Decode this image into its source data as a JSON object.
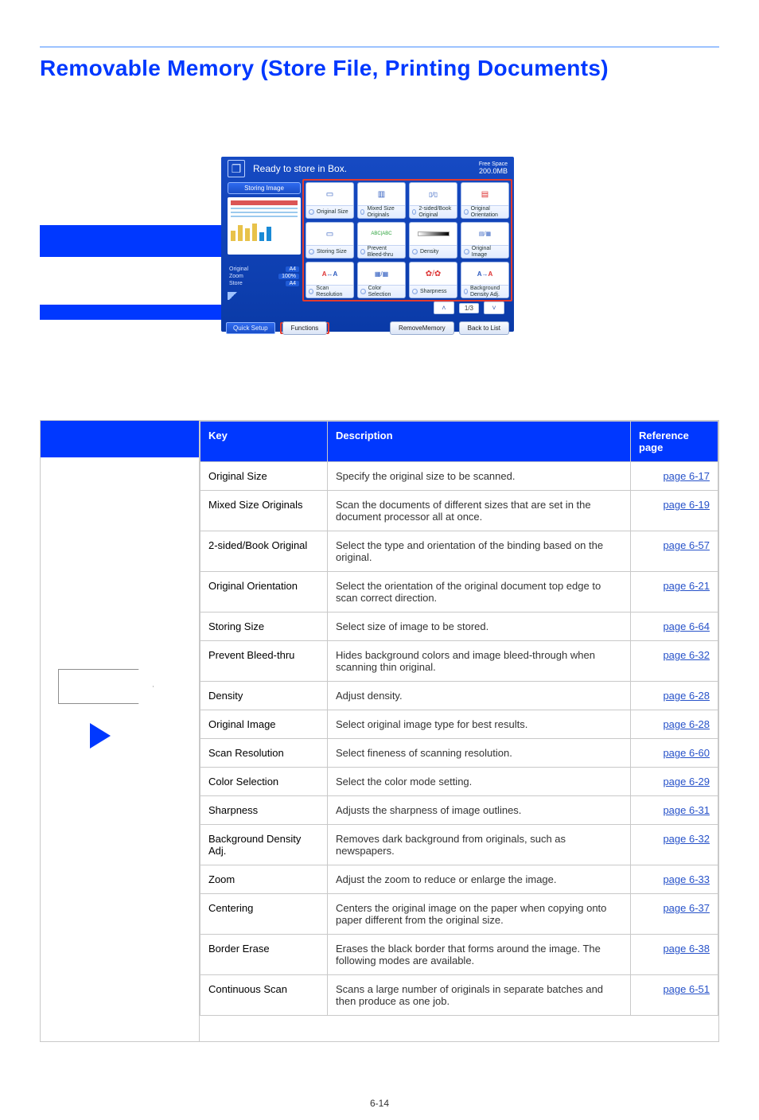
{
  "page_title": "Removable Memory (Store File, Printing Documents)",
  "page_number": "6-14",
  "panel": {
    "title": "Ready to store in Box.",
    "free_space_label": "Free Space",
    "free_space_value": "200.0MB",
    "storing_image": "Storing Image",
    "kv": {
      "original_label": "Original",
      "original_value": "A4",
      "zoom_label": "Zoom",
      "zoom_value": "100%",
      "store_label": "Store",
      "store_value": "A4"
    },
    "tiles": [
      "Original Size",
      "Mixed Size Originals",
      "2-sided/Book Original",
      "Original Orientation",
      "Storing Size",
      "Prevent Bleed-thru",
      "Density",
      "Original Image",
      "Scan Resolution",
      "Color Selection",
      "Sharpness",
      "Background Density Adj."
    ],
    "pager": "1/3",
    "quick_setup": "Quick Setup",
    "functions": "Functions",
    "remove_memory": "RemoveMemory",
    "back_to_list": "Back to List"
  },
  "table": {
    "headers": {
      "key": "Key",
      "desc": "Description",
      "page": "Reference page"
    },
    "rows": [
      {
        "key": "Original Size",
        "desc": "Specify the original size to be scanned.",
        "page": "page 6-17"
      },
      {
        "key": "Mixed Size Originals",
        "desc": "Scan the documents of different sizes that are set in the document processor all at once.",
        "page": "page 6-19"
      },
      {
        "key": "2-sided/Book Original",
        "desc": "Select the type and orientation of the binding based on the original.",
        "page": "page 6-57"
      },
      {
        "key": "Original Orientation",
        "desc": "Select the orientation of the original document top edge to scan correct direction.",
        "page": "page 6-21"
      },
      {
        "key": "Storing Size",
        "desc": "Select size of image to be stored.",
        "page": "page 6-64"
      },
      {
        "key": "Prevent Bleed-thru",
        "desc": "Hides background colors and image bleed-through when scanning thin original.",
        "page": "page 6-32"
      },
      {
        "key": "Density",
        "desc": "Adjust density.",
        "page": "page 6-28"
      },
      {
        "key": "Original Image",
        "desc": "Select original image type for best results.",
        "page": "page 6-28"
      },
      {
        "key": "Scan Resolution",
        "desc": "Select fineness of scanning resolution.",
        "page": "page 6-60"
      },
      {
        "key": "Color Selection",
        "desc": "Select the color mode setting.",
        "page": "page 6-29"
      },
      {
        "key": "Sharpness",
        "desc": "Adjusts the sharpness of image outlines.",
        "page": "page 6-31"
      },
      {
        "key": "Background Density Adj.",
        "desc": "Removes dark background from originals, such as newspapers.",
        "page": "page 6-32"
      },
      {
        "key": "Zoom",
        "desc": "Adjust the zoom to reduce or enlarge the image.",
        "page": "page 6-33"
      },
      {
        "key": "Centering",
        "desc": "Centers the original image on the paper when copying onto paper different from the original size.",
        "page": "page 6-37"
      },
      {
        "key": "Border Erase",
        "desc": "Erases the black border that forms around the image. The following modes are available.",
        "page": "page 6-38"
      },
      {
        "key": "Continuous Scan",
        "desc": "Scans a large number of originals in separate batches and then produce as one job.",
        "page": "page 6-51"
      }
    ]
  }
}
